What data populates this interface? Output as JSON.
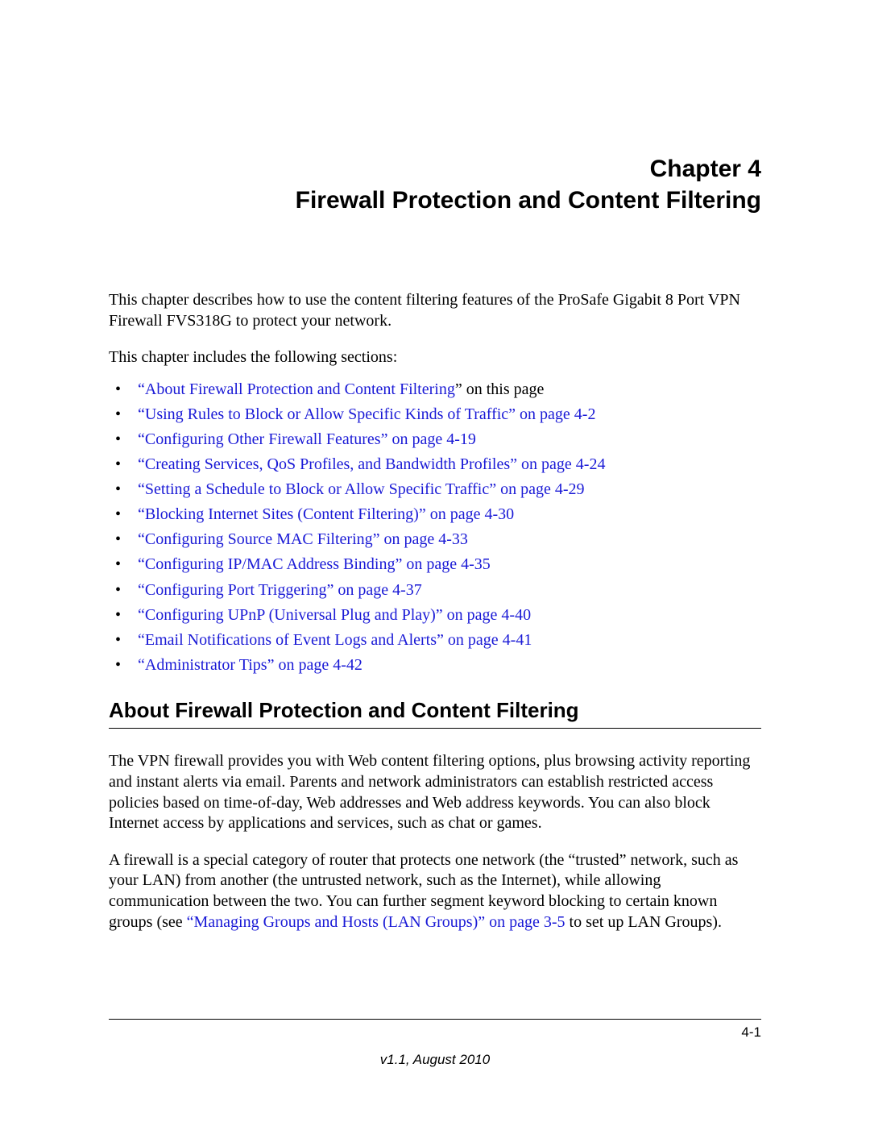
{
  "chapter": {
    "line1": "Chapter 4",
    "line2": "Firewall Protection and Content Filtering"
  },
  "intro1": "This chapter describes how to use the content filtering features of the ProSafe Gigabit 8 Port VPN Firewall FVS318G to protect your network.",
  "intro2": "This chapter includes the following sections:",
  "toc": [
    {
      "link": "“About Firewall Protection and Content Filtering",
      "suffix": "” on this page"
    },
    {
      "link": "“Using Rules to Block or Allow Specific Kinds of Traffic” on page 4-2",
      "suffix": ""
    },
    {
      "link": "“Configuring Other Firewall Features” on page 4-19",
      "suffix": ""
    },
    {
      "link": "“Creating Services, QoS Profiles, and Bandwidth Profiles” on page 4-24",
      "suffix": ""
    },
    {
      "link": "“Setting a Schedule to Block or Allow Specific Traffic” on page 4-29",
      "suffix": ""
    },
    {
      "link": "“Blocking Internet Sites (Content Filtering)” on page 4-30",
      "suffix": ""
    },
    {
      "link": "“Configuring Source MAC Filtering” on page 4-33",
      "suffix": ""
    },
    {
      "link": "“Configuring IP/MAC Address Binding” on page 4-35",
      "suffix": ""
    },
    {
      "link": "“Configuring Port Triggering” on page 4-37",
      "suffix": ""
    },
    {
      "link": "“Configuring UPnP (Universal Plug and Play)” on page 4-40",
      "suffix": ""
    },
    {
      "link": "“Email Notifications of Event Logs and Alerts” on page 4-41",
      "suffix": ""
    },
    {
      "link": "“Administrator Tips” on page 4-42",
      "suffix": ""
    }
  ],
  "section_heading": "About Firewall Protection and Content Filtering",
  "para1": "The VPN firewall provides you with Web content filtering options, plus browsing activity reporting and instant alerts via email. Parents and network administrators can establish restricted access policies based on time-of-day, Web addresses and Web address keywords. You can also block Internet access by applications and services, such as chat or games.",
  "para2_pre": "A firewall is a special category of router that protects one network (the “trusted” network, such as your LAN) from another (the untrusted network, such as the Internet), while allowing communication between the two. You can further segment keyword blocking to certain known groups (see ",
  "para2_link": "“Managing Groups and Hosts (LAN Groups)” on page 3-5",
  "para2_post": " to set up LAN Groups).",
  "footer": {
    "page": "4-1",
    "version": "v1.1, August 2010"
  }
}
